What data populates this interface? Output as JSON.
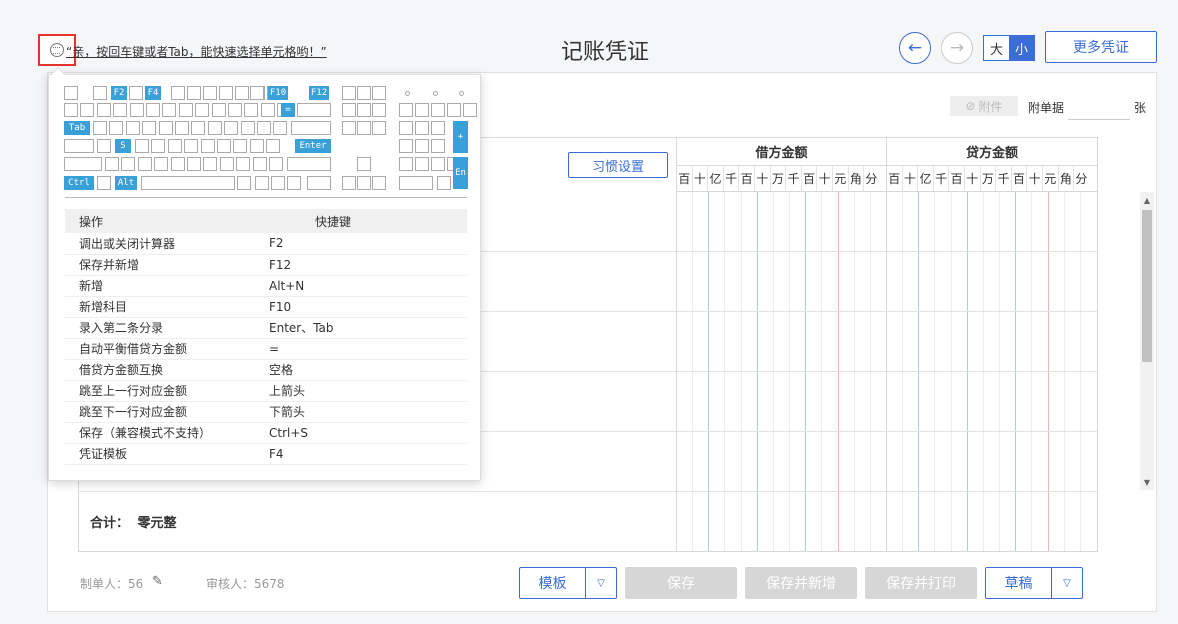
{
  "header": {
    "tip_text": "“亲，按回车键或者Tab，能快速选择单元格哟！”",
    "title": "记账凭证",
    "size_big": "大",
    "size_small": "小",
    "more_button": "更多凭证",
    "prev_icon": "arrow-left-icon",
    "next_icon": "arrow-right-icon"
  },
  "attachment": {
    "button_label": "附件",
    "count_label": "附单据",
    "count_value": "",
    "unit": "张"
  },
  "grid": {
    "habit_button": "习惯设置",
    "debit_header": "借方金额",
    "credit_header": "贷方金额",
    "digit_units": [
      "百",
      "十",
      "亿",
      "千",
      "百",
      "十",
      "万",
      "千",
      "百",
      "十",
      "元",
      "角",
      "分"
    ],
    "total_label": "合计：",
    "total_value": "零元整"
  },
  "footer": {
    "maker_label": "制单人：56",
    "reviewer_label": "审核人：5678",
    "template_button": "模板",
    "save_button": "保存",
    "save_new_button": "保存并新增",
    "save_print_button": "保存并打印",
    "draft_button": "草稿"
  },
  "keyboard": {
    "keys": {
      "f2": "F2",
      "f4": "F4",
      "f10": "F10",
      "f12": "F12",
      "equal": "=",
      "tab": "Tab",
      "s": "S",
      "enter": "Enter",
      "ctrl": "Ctrl",
      "alt": "Alt",
      "plus": "+",
      "en": "En"
    }
  },
  "shortcuts": {
    "col_action": "操作",
    "col_key": "快捷键",
    "rows": [
      {
        "action": "调出或关闭计算器",
        "key": "F2"
      },
      {
        "action": "保存并新增",
        "key": "F12"
      },
      {
        "action": "新增",
        "key": "Alt+N"
      },
      {
        "action": "新增科目",
        "key": "F10"
      },
      {
        "action": "录入第二条分录",
        "key": "Enter、Tab"
      },
      {
        "action": "自动平衡借贷方金额",
        "key": "="
      },
      {
        "action": "借贷方金额互换",
        "key": "空格"
      },
      {
        "action": "跳至上一行对应金额",
        "key": "上箭头"
      },
      {
        "action": "跳至下一行对应金额",
        "key": "下箭头"
      },
      {
        "action": "保存（兼容模式不支持）",
        "key": "Ctrl+S"
      },
      {
        "action": "凭证模板",
        "key": "F4"
      }
    ]
  },
  "colors": {
    "accent": "#3a6ed6",
    "key_highlight": "#3aa0d8",
    "disabled": "#d6d6d6"
  }
}
